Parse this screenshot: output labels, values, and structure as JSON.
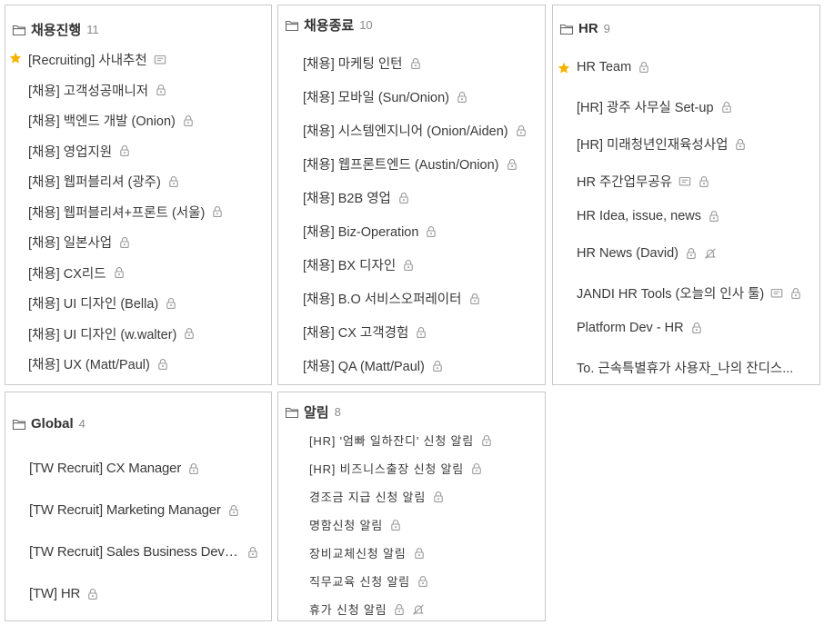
{
  "panels": [
    {
      "title": "채용진행",
      "count": "11",
      "rows": [
        {
          "label": "[Recruiting] 사내추천",
          "star": true,
          "icons": [
            "board-icon"
          ]
        },
        {
          "label": "[채용] 고객성공매니저",
          "icons": [
            "lock-icon"
          ]
        },
        {
          "label": "[채용] 백엔드 개발 (Onion)",
          "icons": [
            "lock-icon"
          ]
        },
        {
          "label": "[채용] 영업지원",
          "icons": [
            "lock-icon"
          ]
        },
        {
          "label": "[채용] 웹퍼블리셔 (광주)",
          "icons": [
            "lock-icon"
          ]
        },
        {
          "label": "[채용] 웹퍼블리셔+프론트 (서울)",
          "icons": [
            "lock-icon"
          ]
        },
        {
          "label": "[채용] 일본사업",
          "icons": [
            "lock-icon"
          ]
        },
        {
          "label": "[채용] CX리드",
          "icons": [
            "lock-icon"
          ]
        },
        {
          "label": "[채용] UI 디자인 (Bella)",
          "icons": [
            "lock-icon"
          ]
        },
        {
          "label": "[채용] UI 디자인 (w.walter)",
          "icons": [
            "lock-icon"
          ]
        },
        {
          "label": "[채용] UX (Matt/Paul)",
          "icons": [
            "lock-icon"
          ]
        }
      ]
    },
    {
      "title": "채용종료",
      "count": "10",
      "rows": [
        {
          "label": "[채용] 마케팅 인턴",
          "icons": [
            "lock-icon"
          ]
        },
        {
          "label": "[채용] 모바일 (Sun/Onion)",
          "icons": [
            "lock-icon"
          ]
        },
        {
          "label": "[채용] 시스템엔지니어 (Onion/Aiden)",
          "icons": [
            "lock-icon"
          ]
        },
        {
          "label": "[채용] 웹프론트엔드 (Austin/Onion)",
          "icons": [
            "lock-icon"
          ]
        },
        {
          "label": "[채용] B2B 영업",
          "icons": [
            "lock-icon"
          ]
        },
        {
          "label": "[채용] Biz-Operation",
          "icons": [
            "lock-icon"
          ]
        },
        {
          "label": "[채용] BX 디자인",
          "icons": [
            "lock-icon"
          ]
        },
        {
          "label": "[채용] B.O 서비스오퍼레이터",
          "icons": [
            "lock-icon"
          ]
        },
        {
          "label": "[채용] CX 고객경험",
          "icons": [
            "lock-icon"
          ]
        },
        {
          "label": "[채용] QA (Matt/Paul)",
          "icons": [
            "lock-icon"
          ]
        }
      ]
    },
    {
      "title": "HR",
      "count": "9",
      "rows": [
        {
          "label": "HR Team",
          "star": true,
          "icons": [
            "lock-icon"
          ]
        },
        {
          "label": "[HR] 광주 사무실 Set-up",
          "icons": [
            "lock-icon"
          ]
        },
        {
          "label": "[HR] 미래청년인재육성사업",
          "icons": [
            "lock-icon"
          ]
        },
        {
          "label": "HR 주간업무공유",
          "icons": [
            "board-icon",
            "lock-icon"
          ]
        },
        {
          "label": "HR Idea, issue, news",
          "icons": [
            "lock-icon"
          ]
        },
        {
          "label": "HR News (David)",
          "icons": [
            "lock-icon",
            "bell-off-icon"
          ]
        },
        {
          "label": "JANDI HR Tools (오늘의 인사 툴)",
          "icons": [
            "board-icon",
            "lock-icon"
          ]
        },
        {
          "label": "Platform Dev - HR",
          "icons": [
            "lock-icon"
          ]
        },
        {
          "label": "To. 근속특별휴가 사용자_나의 잔디스...",
          "icons": []
        }
      ]
    },
    {
      "title": "Global",
      "count": "4",
      "rows": [
        {
          "label": "[TW Recruit] CX Manager",
          "icons": [
            "lock-icon"
          ]
        },
        {
          "label": "[TW Recruit] Marketing Manager",
          "icons": [
            "lock-icon"
          ]
        },
        {
          "label": "[TW Recruit] Sales Business Devel...",
          "icons": [
            "lock-icon"
          ]
        },
        {
          "label": "[TW] HR",
          "icons": [
            "lock-icon"
          ]
        }
      ]
    },
    {
      "title": "알림",
      "count": "8",
      "rows": [
        {
          "label": "[HR] '엄빠 일하잔디' 신청 알림",
          "icons": [
            "lock-icon"
          ]
        },
        {
          "label": "[HR] 비즈니스출장 신청 알림",
          "icons": [
            "lock-icon"
          ]
        },
        {
          "label": "경조금 지급 신청 알림",
          "icons": [
            "lock-icon"
          ]
        },
        {
          "label": "명함신청 알림",
          "icons": [
            "lock-icon"
          ]
        },
        {
          "label": "장비교체신청 알림",
          "icons": [
            "lock-icon"
          ]
        },
        {
          "label": "직무교육 신청 알림",
          "icons": [
            "lock-icon"
          ]
        },
        {
          "label": "휴가 신청 알림",
          "icons": [
            "lock-icon",
            "bell-off-icon"
          ]
        }
      ]
    }
  ],
  "colors": {
    "star": "#f5b400",
    "icon": "#9a9a9a",
    "border": "#c9c9c9",
    "text": "#3a3a3a",
    "count": "#8a8a8a"
  }
}
